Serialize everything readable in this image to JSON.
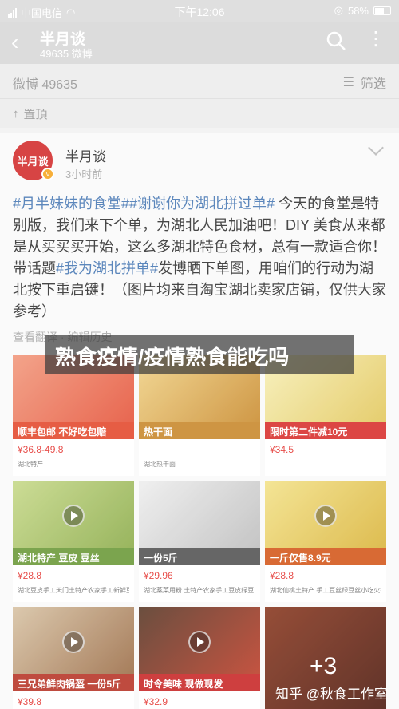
{
  "status": {
    "carrier": "中国电信",
    "time": "下午12:06",
    "battery": "58%"
  },
  "header": {
    "name": "半月谈",
    "subtitle": "49635 微博"
  },
  "subheader": {
    "title": "微博 49635",
    "filter": "筛选"
  },
  "pinned": {
    "label": "置頂"
  },
  "post": {
    "author": "半月谈",
    "avatar_text": "半月谈",
    "time": "3小时前",
    "tag1": "#月半妹妹的食堂#",
    "tag2": "#谢谢你为湖北拼过单#",
    "text1": " 今天的食堂是特别版，我们来下个单，为湖北人民加油吧！DIY 美食从来都是从买买买开始，这么多湖北特色食材，总有一款适合你！带话题",
    "tag3": "#我为湖北拼单#",
    "text2": "发博晒下单图，用咱们的行动为湖北按下重启键！（图片均来自淘宝湖北卖家店铺，仅供大家参考）",
    "meta": "查看翻译 · 编辑历史"
  },
  "grid": [
    {
      "band": "顺丰包邮 不好吃包赔",
      "price": "¥36.8-49.8",
      "desc": "湖北特产",
      "color": "#e44b2f",
      "play": false
    },
    {
      "band": "热干面",
      "price": "",
      "desc": "湖北热干面",
      "color": "#c98a2e",
      "play": false
    },
    {
      "band": "限时第二件减10元",
      "price": "¥34.5",
      "desc": "",
      "color": "#d8322f",
      "play": false
    },
    {
      "band": "湖北特产 豆皮 豆丝",
      "price": "¥28.8",
      "desc": "湖北豆皮手工天门土特产农家手工新鲜豆丝",
      "color": "#6d9a3a",
      "play": true
    },
    {
      "band": "一份5斤",
      "price": "¥29.96",
      "desc": "湖北蒸菜用粉 土特产农家手工豆皮绿豆",
      "color": "#555555",
      "play": false
    },
    {
      "band": "一斤仅售8.9元",
      "price": "¥28.8",
      "desc": "湖北仙桃土特产 手工豆丝绿豆丝小吃火锅",
      "color": "#d45a1e",
      "play": true
    },
    {
      "band": "三兄弟鲜肉锅盔 一份5斤",
      "price": "¥39.8",
      "desc": "",
      "color": "#b8372a",
      "play": true
    },
    {
      "band": "时令美味 现做现发",
      "price": "¥32.9",
      "desc": "",
      "color": "#c92a2a",
      "play": true
    },
    {
      "band": "",
      "price": "",
      "desc": "",
      "color": "#7a2a1a",
      "play": false
    }
  ],
  "banner": "熟食疫情/疫情熟食能吃吗",
  "more_count": "+3",
  "watermark": "知乎 @秋食工作室"
}
